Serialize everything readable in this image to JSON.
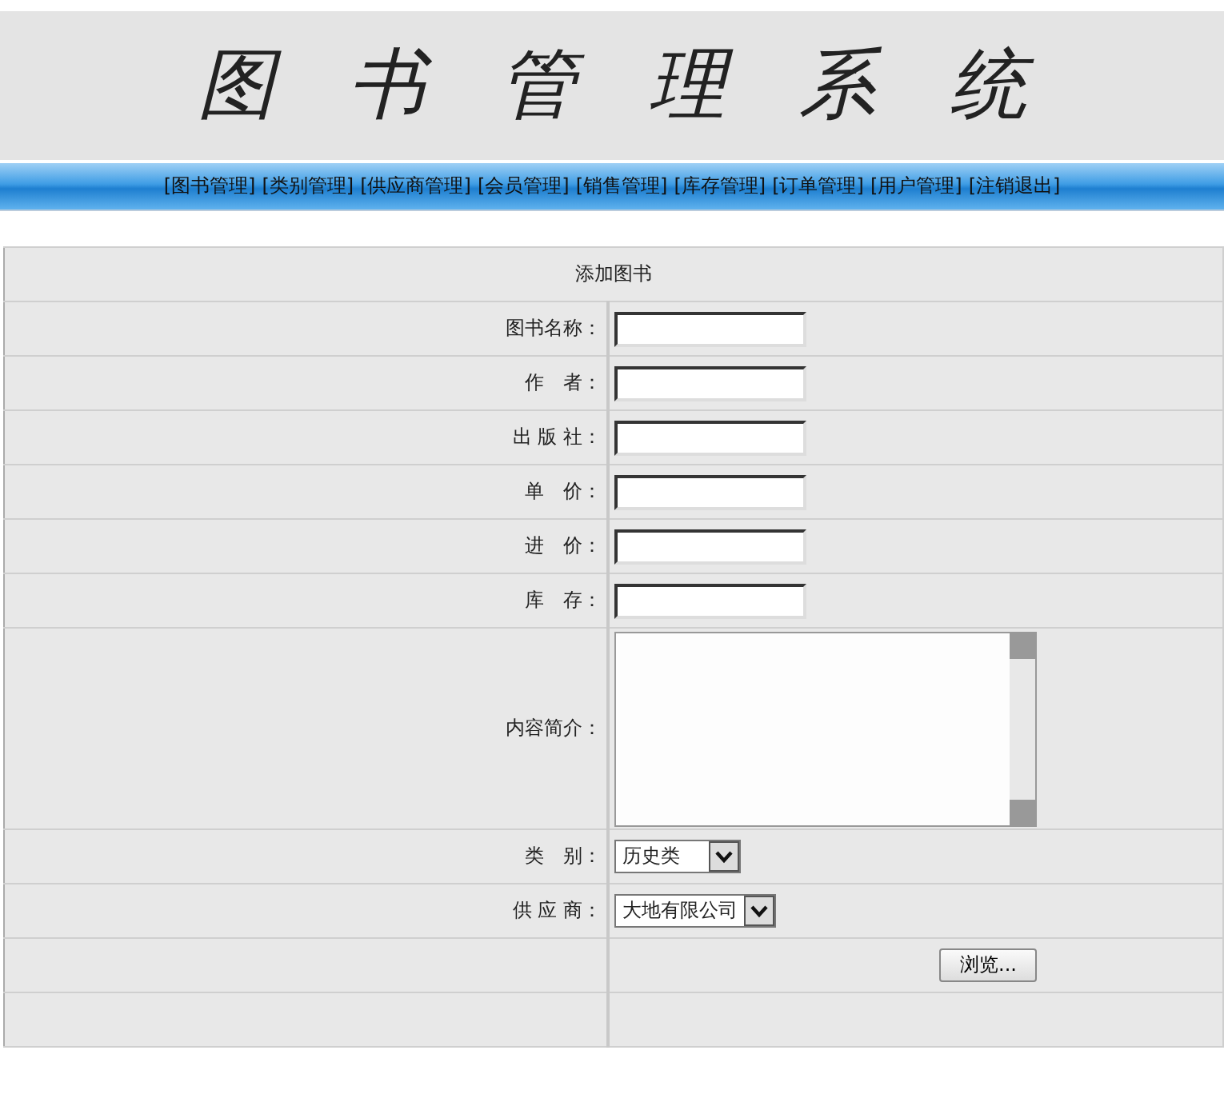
{
  "header": {
    "title": "图 书 管 理 系 统"
  },
  "nav": [
    "[图书管理]",
    "[类别管理]",
    "[供应商管理]",
    "[会员管理]",
    "[销售管理]",
    "[库存管理]",
    "[订单管理]",
    "[用户管理]",
    "[注销退出]"
  ],
  "form": {
    "title": "添加图书",
    "fields": [
      {
        "kind": "text",
        "label": "图书名称："
      },
      {
        "kind": "text",
        "label": "作　者："
      },
      {
        "kind": "text",
        "label": "出 版 社："
      },
      {
        "kind": "text",
        "label": "单　价："
      },
      {
        "kind": "text",
        "label": "进　价："
      },
      {
        "kind": "text",
        "label": "库　存："
      },
      {
        "kind": "textarea",
        "label": "内容简介："
      },
      {
        "kind": "select",
        "label": "类　别：",
        "value": "历史类"
      },
      {
        "kind": "select",
        "label": "供 应 商：",
        "value": "大地有限公司"
      },
      {
        "kind": "file",
        "button": "浏览..."
      }
    ]
  }
}
